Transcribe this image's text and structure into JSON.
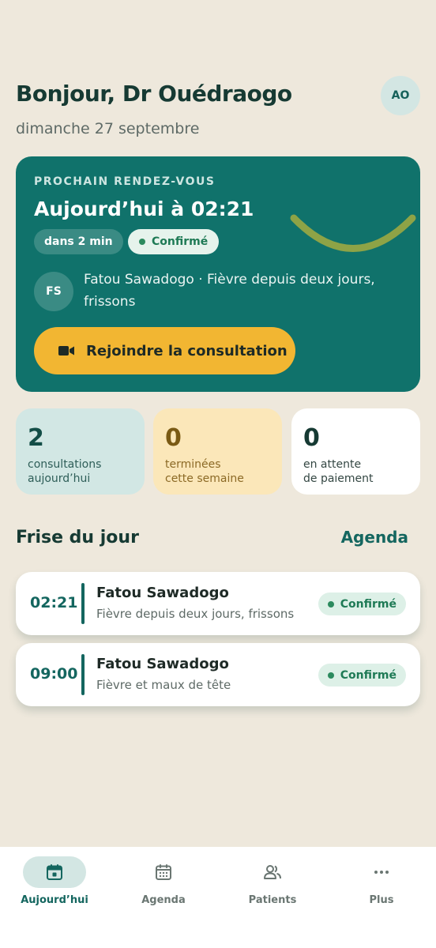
{
  "header": {
    "greeting": "Bonjour, Dr Ouédraogo",
    "date": "dimanche 27 septembre",
    "avatar_initials": "AO"
  },
  "next_appointment": {
    "overline": "PROCHAIN RENDEZ-VOUS",
    "time": "Aujourd’hui à 02:21",
    "countdown": "dans 2 min",
    "status": "Confirmé",
    "patient_initials": "FS",
    "description": "Fatou Sawadogo · Fièvre depuis deux jours, frissons",
    "join_label": "Rejoindre la consultation"
  },
  "stats": [
    {
      "value": "2",
      "label_line1": "consultations",
      "label_line2": "aujourd’hui"
    },
    {
      "value": "0",
      "label_line1": "terminées",
      "label_line2": "cette semaine"
    },
    {
      "value": "0",
      "label_line1": "en attente",
      "label_line2": "de paiement"
    }
  ],
  "timeline": {
    "title": "Frise du jour",
    "agenda_link": "Agenda",
    "items": [
      {
        "time": "02:21",
        "name": "Fatou Sawadogo",
        "reason": "Fièvre depuis deux jours, frissons",
        "status": "Confirmé"
      },
      {
        "time": "09:00",
        "name": "Fatou Sawadogo",
        "reason": "Fièvre et maux de tête",
        "status": "Confirmé"
      }
    ]
  },
  "nav": {
    "items": [
      {
        "label": "Aujourd’hui",
        "icon": "calendar-today-icon",
        "active": true
      },
      {
        "label": "Agenda",
        "icon": "calendar-grid-icon",
        "active": false
      },
      {
        "label": "Patients",
        "icon": "people-icon",
        "active": false
      },
      {
        "label": "Plus",
        "icon": "more-horizontal-icon",
        "active": false
      }
    ]
  },
  "colors": {
    "background": "#EEE8DC",
    "primary": "#10726B",
    "accent": "#F2B632",
    "success": "#1E7A55"
  }
}
